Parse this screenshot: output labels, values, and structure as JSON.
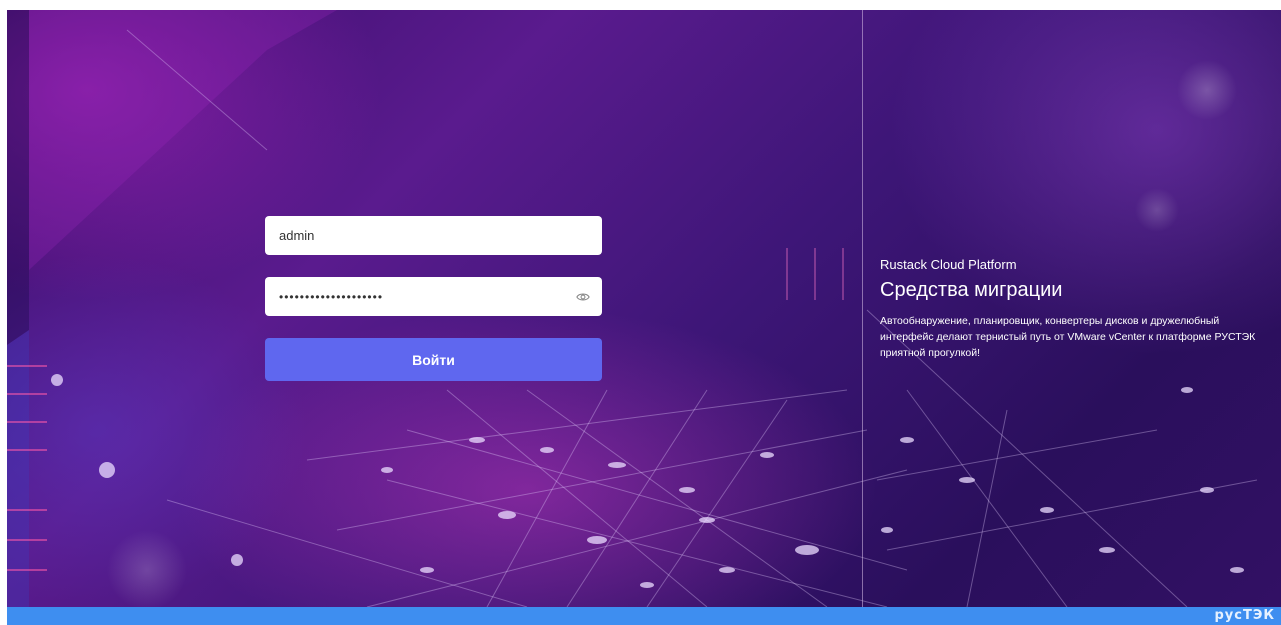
{
  "login_form": {
    "username_value": "admin",
    "password_value": "••••••••••••••••••••",
    "password_icon": "eye-icon",
    "submit_label": "Войти"
  },
  "promo": {
    "product": "Rustack Cloud Platform",
    "title": "Средства миграции",
    "description": "Автообнаружение, планировщик, конвертеры дисков и дружелюбный интерфейс делают тернистый путь от VMware vCenter к платформе РУСТЭК приятной прогулкой!"
  },
  "footer": {
    "logo_text": "русТЭК",
    "color": "#3e8ef0"
  },
  "colors": {
    "button": "#5f67ef",
    "background_primary": "#4a1680",
    "background_accent": "#b43cc8"
  }
}
